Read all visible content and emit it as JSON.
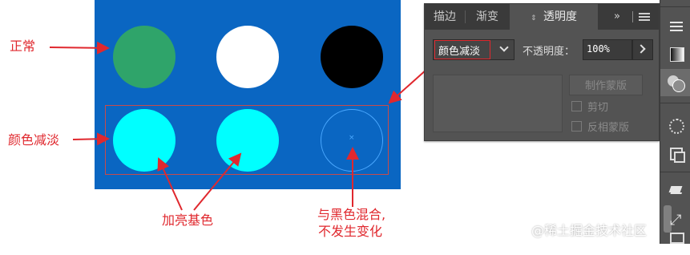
{
  "colors": {
    "canvas_blue": "#0a66c2",
    "annotation_red": "#e0282e",
    "circle_green": "#2fa46a",
    "circle_white": "#ffffff",
    "circle_black": "#000000",
    "circle_cyan": "#00ffff",
    "panel_bg": "#535353",
    "panel_tabbar": "#3a3a3a"
  },
  "annotations": {
    "normal": "正常",
    "color_dodge": "颜色减淡",
    "lighten_base": "加亮基色",
    "black_mix_line1": "与黑色混合,",
    "black_mix_line2": "不发生变化"
  },
  "transparency_panel": {
    "tabs": [
      {
        "label": "描边",
        "icon": ""
      },
      {
        "label": "渐变",
        "icon": ""
      },
      {
        "label": "透明度",
        "icon": "updown-arrows-icon"
      }
    ],
    "overflow_icon": "double-chevron-right-icon",
    "menu_icon": "hamburger-menu-icon",
    "blend_mode": "颜色减淡",
    "opacity_label": "不透明度：",
    "opacity_value": "100%",
    "make_mask_button": "制作蒙版",
    "clip_label": "剪切",
    "invert_mask_label": "反相蒙版"
  },
  "right_toolbar": {
    "icons": [
      "hamburger-menu-icon",
      "gradient-swatch-icon",
      "transparency-circles-icon",
      "appearance-circle-icon",
      "transform-icon",
      "layers-icon",
      "expand-icon",
      "artboards-icon"
    ]
  },
  "watermark": "@稀土掘金技术社区"
}
